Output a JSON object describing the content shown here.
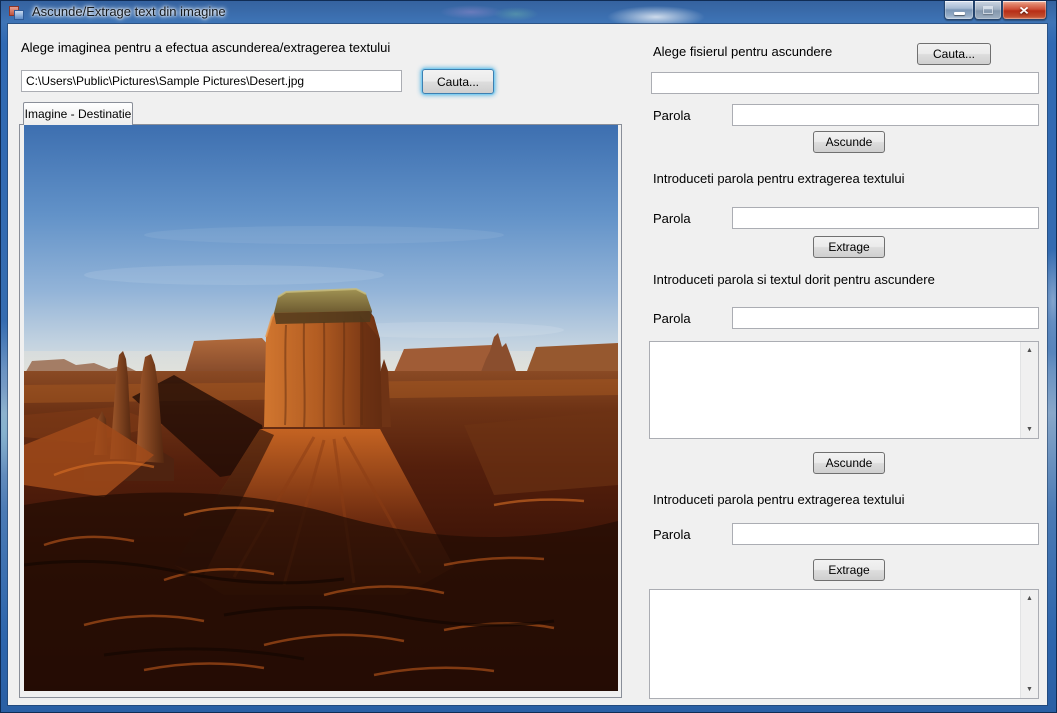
{
  "window": {
    "title": "Ascunde/Extrage text din imagine",
    "titlebar_color": "#2f69b3",
    "close_button_color": "#b82e17",
    "client_background": "#f0f0f0"
  },
  "icons": {
    "close": "×",
    "scroll_up": "▲",
    "scroll_down": "▼"
  },
  "left_panel": {
    "instruction": "Alege imaginea pentru a efectua ascunderea/extragerea textului",
    "image_path": {
      "value": "C:\\Users\\Public\\Pictures\\Sample Pictures\\Desert.jpg",
      "placeholder": ""
    },
    "browse_button": "Cauta...",
    "tab_label": "Imagine - Destinatie",
    "image_description": "Desert photo: Monument Valley butte at sunset under blue sky"
  },
  "right_panel": {
    "hide_file": {
      "instruction": "Alege fisierul pentru ascundere",
      "browse_button": "Cauta...",
      "file_value": "",
      "password_label": "Parola",
      "password_value": "",
      "action_button": "Ascunde"
    },
    "extract_file": {
      "instruction": "Introduceti parola pentru extragerea textului",
      "password_label": "Parola",
      "password_value": "",
      "action_button": "Extrage"
    },
    "hide_text": {
      "instruction": "Introduceti parola si textul dorit pentru ascundere",
      "password_label": "Parola",
      "password_value": "",
      "text_value": "",
      "action_button": "Ascunde"
    },
    "extract_text": {
      "instruction": "Introduceti parola pentru extragerea textului",
      "password_label": "Parola",
      "password_value": "",
      "action_button": "Extrage",
      "output_value": ""
    }
  }
}
